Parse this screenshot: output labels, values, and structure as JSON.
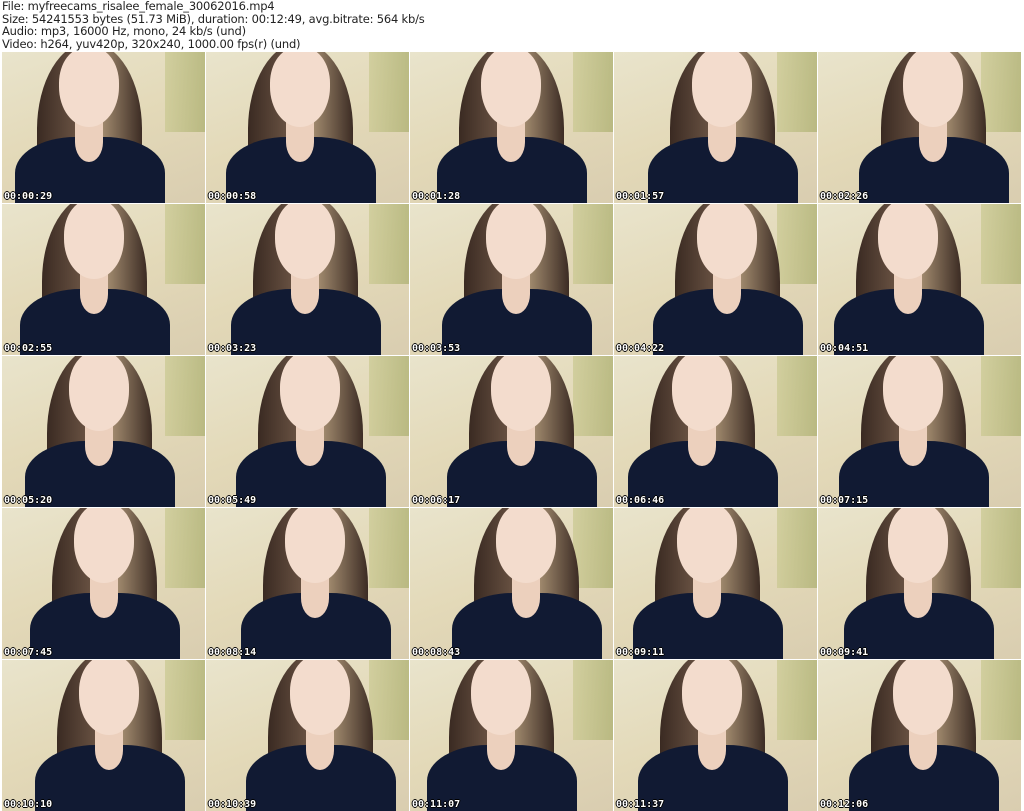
{
  "header": {
    "file": "File: myfreecams_risalee_female_30062016.mp4",
    "size": "Size: 54241553 bytes (51.73 MiB), duration: 00:12:49, avg.bitrate: 564 kb/s",
    "audio": "Audio: mp3, 16000 Hz, mono, 24 kb/s (und)",
    "video": "Video: h264, yuv420p, 320x240, 1000.00 fps(r) (und)"
  },
  "timestamps": [
    "00:00:29",
    "00:00:58",
    "00:01:28",
    "00:01:57",
    "00:02:26",
    "00:02:55",
    "00:03:23",
    "00:03:53",
    "00:04:22",
    "00:04:51",
    "00:05:20",
    "00:05:49",
    "00:06:17",
    "00:06:46",
    "00:07:15",
    "00:07:45",
    "00:08:14",
    "00:08:43",
    "00:09:11",
    "00:09:41",
    "00:10:10",
    "00:10:39",
    "00:11:07",
    "00:11:37",
    "00:12:06"
  ]
}
